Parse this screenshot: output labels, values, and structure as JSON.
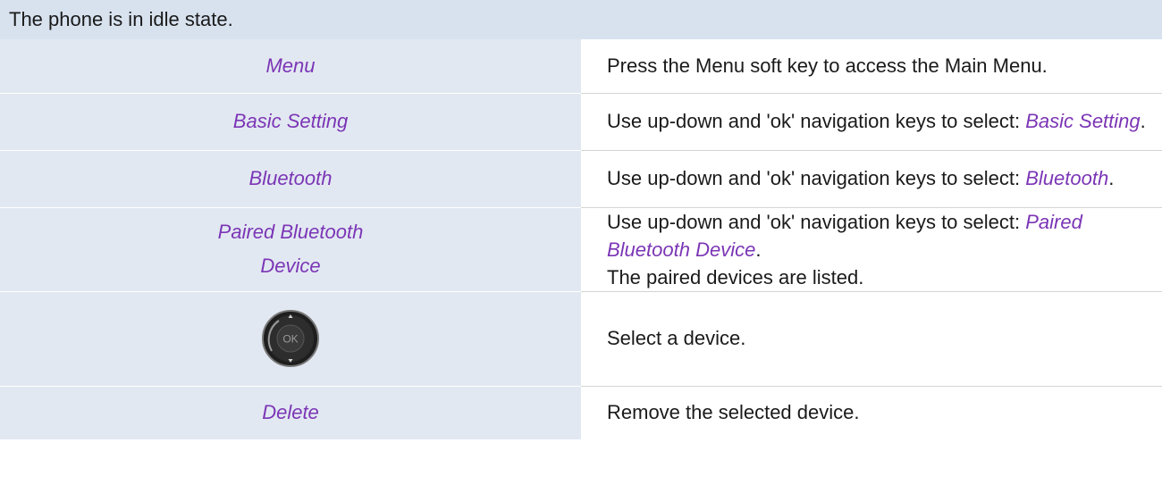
{
  "header": {
    "text": "The phone is in idle state."
  },
  "steps": [
    {
      "left": "Menu",
      "right": "Press the Menu soft key to access the Main Menu."
    },
    {
      "left": "Basic Setting",
      "right_prefix": "Use up-down and 'ok' navigation keys to select: ",
      "right_ref": "Basic Setting",
      "right_suffix": "."
    },
    {
      "left": "Bluetooth",
      "right_prefix": "Use up-down and 'ok' navigation keys to select: ",
      "right_ref": "Bluetooth",
      "right_suffix": "."
    },
    {
      "left_line1": "Paired Bluetooth",
      "left_line2": "Device",
      "right_prefix": "Use up-down and 'ok' navigation keys to select: ",
      "right_ref": "Paired Bluetooth Device",
      "right_suffix": ".",
      "right_line2": "The paired devices are listed."
    },
    {
      "left_icon": "navigation-ok-key-icon",
      "left_icon_text": "OK",
      "right": "Select a device."
    },
    {
      "left": "Delete",
      "right": "Remove the selected device."
    }
  ],
  "colors": {
    "header_bg": "#d8e2ef",
    "left_col_bg": "#e2e8f2",
    "menu_ref": "#7b35b5",
    "text": "#1a1a1a"
  }
}
